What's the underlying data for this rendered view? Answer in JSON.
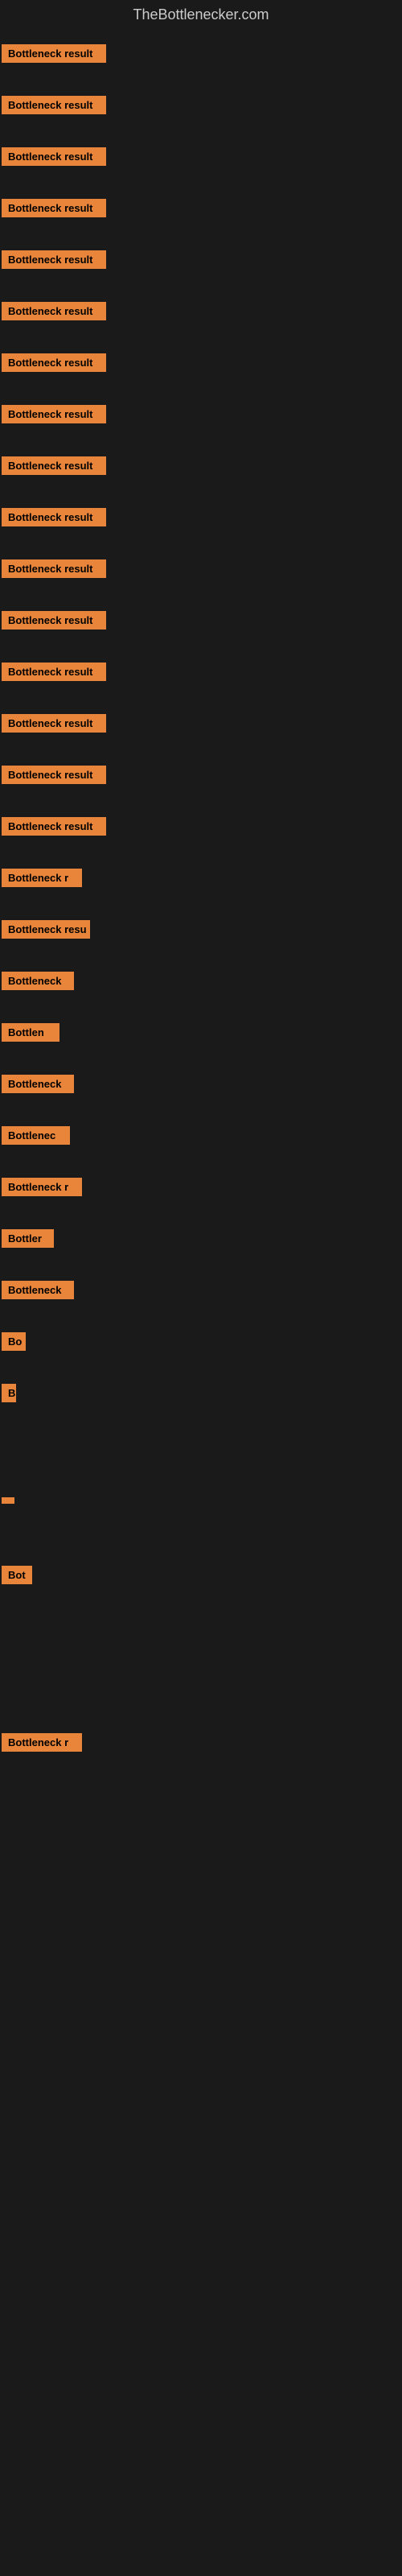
{
  "site": {
    "title": "TheBottlenecker.com"
  },
  "rows": [
    {
      "label": "Bottleneck result",
      "width": 130
    },
    {
      "label": "Bottleneck result",
      "width": 130
    },
    {
      "label": "Bottleneck result",
      "width": 130
    },
    {
      "label": "Bottleneck result",
      "width": 130
    },
    {
      "label": "Bottleneck result",
      "width": 130
    },
    {
      "label": "Bottleneck result",
      "width": 130
    },
    {
      "label": "Bottleneck result",
      "width": 130
    },
    {
      "label": "Bottleneck result",
      "width": 130
    },
    {
      "label": "Bottleneck result",
      "width": 130
    },
    {
      "label": "Bottleneck result",
      "width": 130
    },
    {
      "label": "Bottleneck result",
      "width": 130
    },
    {
      "label": "Bottleneck result",
      "width": 130
    },
    {
      "label": "Bottleneck result",
      "width": 130
    },
    {
      "label": "Bottleneck result",
      "width": 130
    },
    {
      "label": "Bottleneck result",
      "width": 130
    },
    {
      "label": "Bottleneck result",
      "width": 130
    },
    {
      "label": "Bottleneck r",
      "width": 100
    },
    {
      "label": "Bottleneck resu",
      "width": 110
    },
    {
      "label": "Bottleneck",
      "width": 90
    },
    {
      "label": "Bottlen",
      "width": 72
    },
    {
      "label": "Bottleneck",
      "width": 90
    },
    {
      "label": "Bottlenec",
      "width": 85
    },
    {
      "label": "Bottleneck r",
      "width": 100
    },
    {
      "label": "Bottler",
      "width": 65
    },
    {
      "label": "Bottleneck",
      "width": 90
    },
    {
      "label": "Bo",
      "width": 30
    },
    {
      "label": "B",
      "width": 18
    },
    {
      "label": "",
      "width": 0
    },
    {
      "label": "",
      "width": 0
    },
    {
      "label": "",
      "width": 2
    },
    {
      "label": "",
      "width": 0
    },
    {
      "label": "Bot",
      "width": 38
    },
    {
      "label": "",
      "width": 0
    },
    {
      "label": "",
      "width": 0
    },
    {
      "label": "",
      "width": 0
    },
    {
      "label": "",
      "width": 0
    },
    {
      "label": "Bottleneck r",
      "width": 100
    },
    {
      "label": "",
      "width": 0
    },
    {
      "label": "",
      "width": 0
    },
    {
      "label": "",
      "width": 0
    }
  ]
}
